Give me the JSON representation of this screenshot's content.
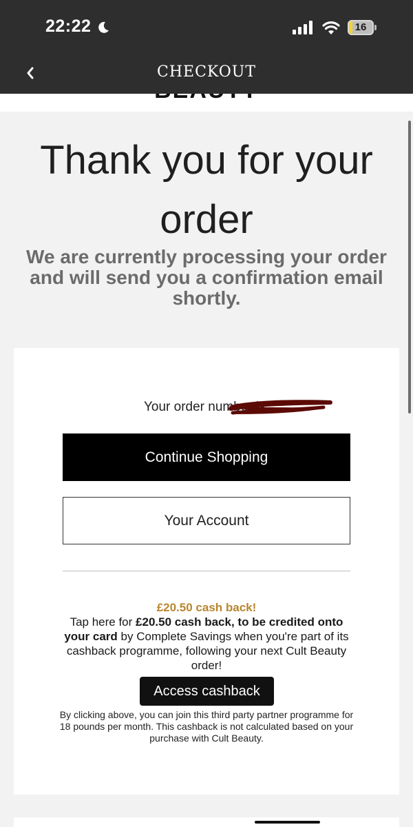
{
  "status_bar": {
    "time": "22:22",
    "battery_level": "16",
    "icons": [
      "moon-icon",
      "signal-icon",
      "wifi-icon",
      "battery-icon"
    ]
  },
  "nav": {
    "title": "CHECKOUT",
    "back_icon": "chevron-left-icon",
    "logo_partial": "BEAUTY"
  },
  "page": {
    "heading": "Thank you for your order",
    "subheading": "We are currently processing your order and will send you a confirmation email shortly."
  },
  "order": {
    "label": "Your order number is:"
  },
  "buttons": {
    "continue_shopping": "Continue Shopping",
    "your_account": "Your Account",
    "access_cashback": "Access cashback"
  },
  "cashback": {
    "title": "£20.50 cash back!",
    "desc_prefix": "Tap here for ",
    "desc_bold": "£20.50 cash back, to be credited onto your card",
    "desc_suffix": " by Complete Savings when you're part of its cashback programme, following your next Cult Beauty order!",
    "disclaimer": "By clicking above, you can join this third party partner programme for 18 pounds per month. This cashback is not calculated based on your purchase with Cult Beauty."
  },
  "colors": {
    "bar_background": "#2e2e2e",
    "accent_gold": "#b8862e",
    "battery_yellow": "#f2d42f",
    "redaction": "#5c0a05"
  }
}
